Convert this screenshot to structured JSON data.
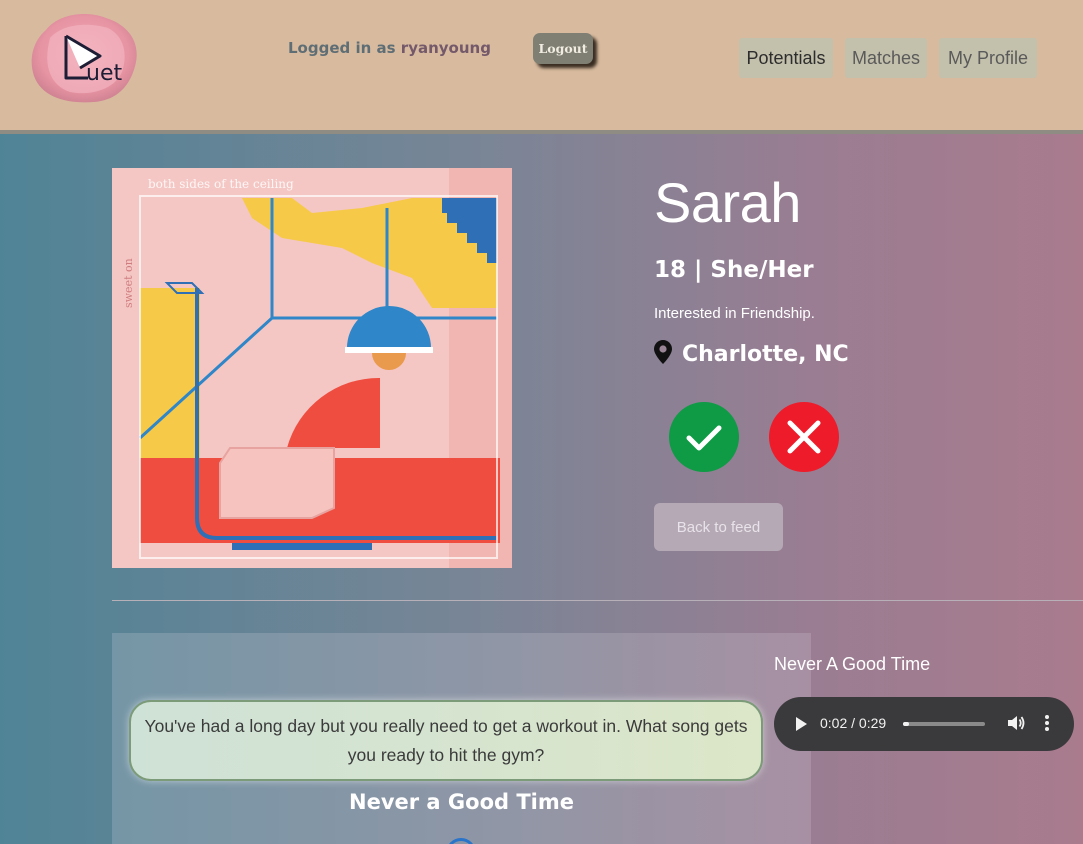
{
  "header": {
    "logged_in_prefix": "Logged in as ",
    "username": "ryanyoung",
    "logout_label": "Logout",
    "nav": {
      "potentials": "Potentials",
      "matches": "Matches",
      "my_profile": "My Profile"
    },
    "logo_text": "uet"
  },
  "profile": {
    "album_cover_text": "both sides of the ceiling",
    "album_cover_artist": "sweet on",
    "name": "Sarah",
    "age_pronouns": "18 | She/Her",
    "interest": "Interested in Friendship.",
    "location": "Charlotte, NC",
    "back_label": "Back to feed"
  },
  "prompt": {
    "question": "You've had a long day but you really need to get a workout in. What song gets you ready to hit the gym?",
    "answer": "Never a Good Time"
  },
  "audio": {
    "song_title": "Never A Good Time",
    "time": "0:02 / 0:29",
    "progress_fraction": 0.069
  },
  "colors": {
    "accept": "#0f9a46",
    "reject": "#ee1b2a",
    "header_bg": "#d8bb9f"
  },
  "icons": [
    "play-icon",
    "location-pin-icon",
    "checkmark-icon",
    "x-icon",
    "volume-icon",
    "more-vert-icon"
  ]
}
